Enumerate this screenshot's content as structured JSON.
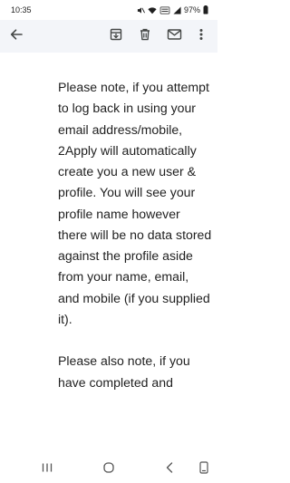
{
  "status_bar": {
    "time": "10:35",
    "battery": "97%",
    "icons": [
      "mute-icon",
      "wifi-icon",
      "volte-icon",
      "signal-icon",
      "battery-icon"
    ]
  },
  "app_bar": {
    "icons": [
      "back-arrow-icon",
      "archive-icon",
      "delete-icon",
      "mark-unread-icon",
      "more-vert-icon"
    ]
  },
  "email": {
    "paragraphs": [
      "Please note, if you attempt to log back in using your email address/mobile, 2Apply will automatically create you a new user & profile. You will see your profile name however there will be no data stored against the profile aside from your name, email, and mobile (if you supplied it).",
      "Please also note, if you have completed and"
    ]
  },
  "nav_bar": {
    "icons": [
      "recents-icon",
      "home-icon",
      "back-icon",
      "keyboard-icon"
    ]
  },
  "colors": {
    "app_bar_bg": "#f3f5f9",
    "text": "#1f1f1f",
    "icon": "#444746"
  }
}
